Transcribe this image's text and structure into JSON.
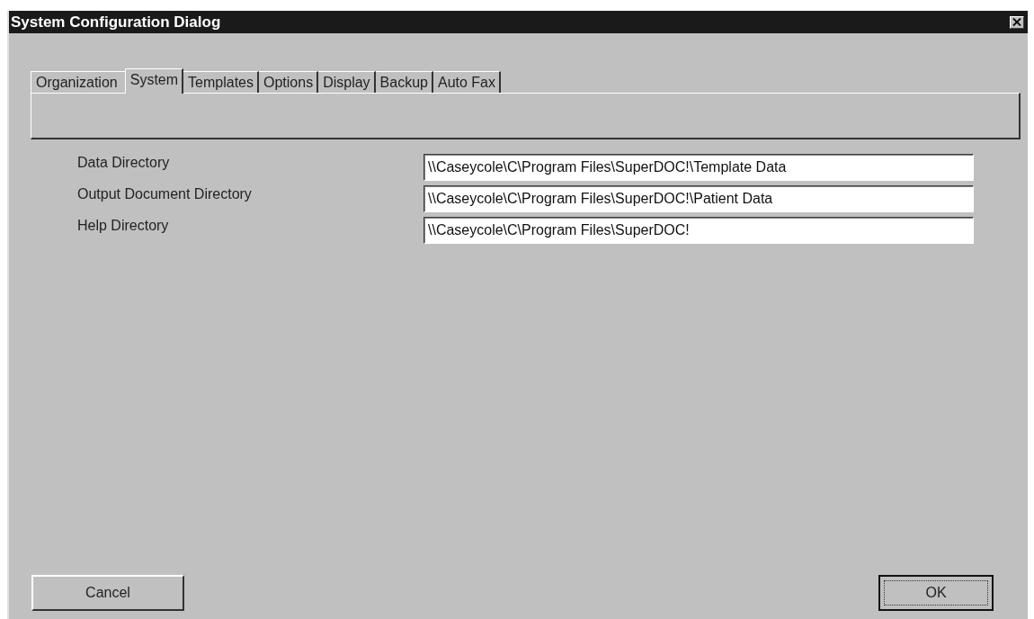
{
  "window": {
    "title": "System Configuration Dialog"
  },
  "tabs": [
    {
      "label": "Organization",
      "selected": false
    },
    {
      "label": "System",
      "selected": true
    },
    {
      "label": "Templates",
      "selected": false
    },
    {
      "label": "Options",
      "selected": false
    },
    {
      "label": "Display",
      "selected": false
    },
    {
      "label": "Backup",
      "selected": false
    },
    {
      "label": "Auto Fax",
      "selected": false
    }
  ],
  "fields": [
    {
      "label": "Data Directory",
      "value": "\\\\Caseycole\\C\\Program Files\\SuperDOC!\\Template Data"
    },
    {
      "label": "Output Document Directory",
      "value": "\\\\Caseycole\\C\\Program Files\\SuperDOC!\\Patient Data"
    },
    {
      "label": "Help Directory",
      "value": "\\\\Caseycole\\C\\Program Files\\SuperDOC!"
    }
  ],
  "buttons": [
    {
      "label": "Cancel",
      "default": false
    },
    {
      "label": "OK",
      "default": true
    }
  ]
}
